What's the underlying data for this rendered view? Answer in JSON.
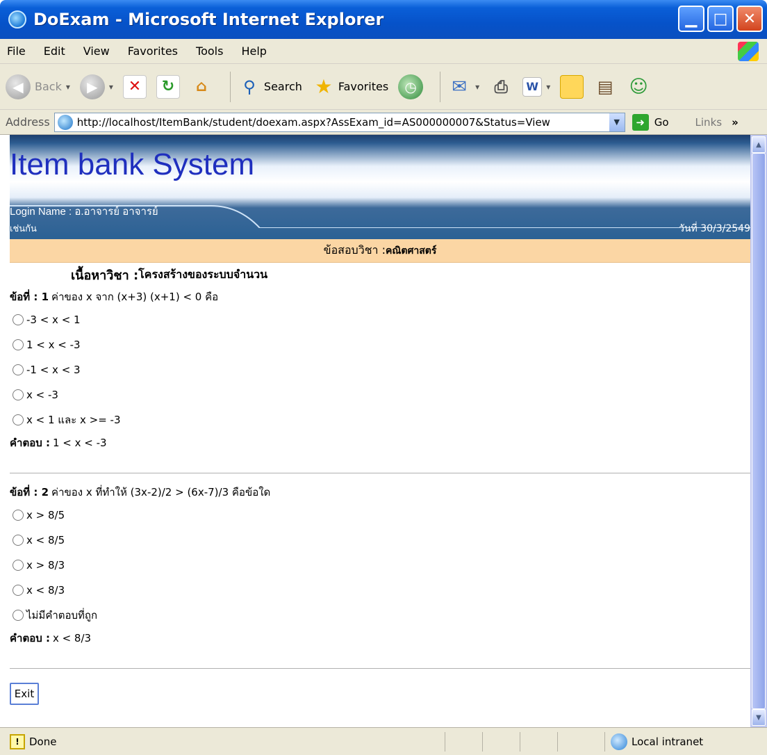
{
  "window": {
    "title": "DoExam - Microsoft Internet Explorer"
  },
  "menu": [
    "File",
    "Edit",
    "View",
    "Favorites",
    "Tools",
    "Help"
  ],
  "toolbar": {
    "back_label": "Back",
    "search_label": "Search",
    "favorites_label": "Favorites"
  },
  "address": {
    "label": "Address",
    "url": "http://localhost/ItemBank/student/doexam.aspx?AssExam_id=AS000000007&Status=View",
    "go_label": "Go",
    "links_label": "Links"
  },
  "page": {
    "brand": "Item bank System",
    "login": "Login Name : อ.อาจารย์ อาจารย์",
    "login_sub": "เช่นกัน",
    "date": "วันที่ 30/3/2549",
    "subject_label": "ข้อสอบวิชา : ",
    "subject_value": "คณิตศาสตร์",
    "topic_label": "เนื้อหาวิชา : ",
    "topic_value": "โครงสร้างของระบบจำนวน",
    "questions": [
      {
        "number_label": "ข้อที่ : 1",
        "text": "ค่าของ x จาก (x+3) (x+1) < 0 คือ",
        "options": [
          "-3 < x < 1",
          "1 < x < -3",
          "-1 < x < 3",
          "x < -3",
          "x < 1 และ x >= -3"
        ],
        "answer_label": "คำตอบ :",
        "answer": "1 < x < -3"
      },
      {
        "number_label": "ข้อที่ : 2",
        "text": "ค่าของ x ที่ทำให้ (3x-2)/2 > (6x-7)/3 คือข้อใด",
        "options": [
          "x > 8/5",
          "x < 8/5",
          "x > 8/3",
          "x < 8/3",
          "ไม่มีคำตอบที่ถูก"
        ],
        "answer_label": "คำตอบ :",
        "answer": "x < 8/3"
      }
    ],
    "exit_label": "Exit"
  },
  "status": {
    "text": "Done",
    "zone": "Local intranet"
  }
}
